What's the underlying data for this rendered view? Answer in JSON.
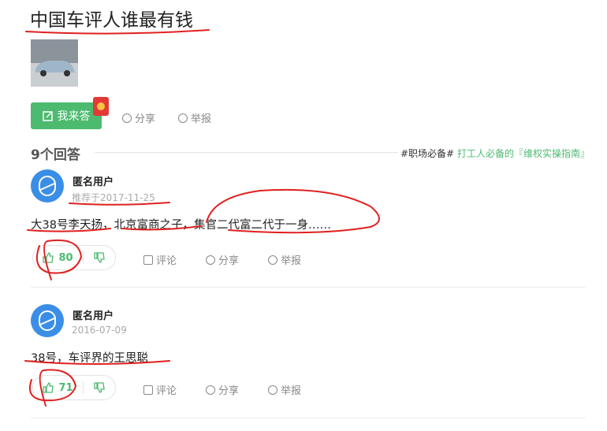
{
  "question": {
    "title": "中国车评人谁最有钱"
  },
  "actions": {
    "answer_label": "我来答",
    "share_label": "分享",
    "report_label": "举报"
  },
  "answers_header": {
    "count_label": "9个回答",
    "promo_prefix": "#职场必备#",
    "promo_link": "打工人必备的『维权实操指南』"
  },
  "answers": [
    {
      "user": "匿名用户",
      "date": "推荐于2017-11-25",
      "content": "大38号李天扬，北京富商之子，集官二代富二代于一身……",
      "likes": "80",
      "comment_label": "评论",
      "share_label": "分享",
      "report_label": "举报"
    },
    {
      "user": "匿名用户",
      "date": "2016-07-09",
      "content": "38号，车评界的王思聪",
      "likes": "71",
      "comment_label": "评论",
      "share_label": "分享",
      "report_label": "举报"
    }
  ],
  "colors": {
    "accent": "#4cba6f",
    "annotation": "#e02020",
    "avatar": "#3a8ee6"
  }
}
